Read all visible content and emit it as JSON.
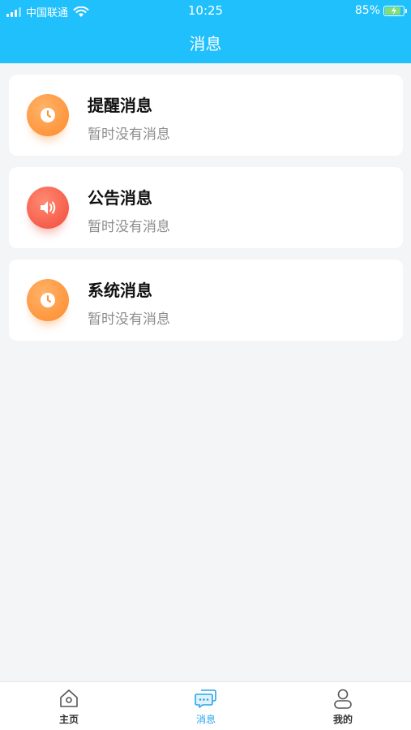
{
  "status_bar": {
    "carrier": "中国联通",
    "time": "10:25",
    "battery": "85%"
  },
  "header": {
    "title": "消息"
  },
  "messages": [
    {
      "title": "提醒消息",
      "subtitle": "暂时没有消息",
      "icon": "clock-icon",
      "color": "#ff8f33"
    },
    {
      "title": "公告消息",
      "subtitle": "暂时没有消息",
      "icon": "speaker-icon",
      "color": "#f25340"
    },
    {
      "title": "系统消息",
      "subtitle": "暂时没有消息",
      "icon": "clock-icon",
      "color": "#ff8f33"
    }
  ],
  "tabbar": {
    "items": [
      {
        "label": "主页",
        "icon": "home-icon"
      },
      {
        "label": "消息",
        "icon": "chat-icon",
        "active": true
      },
      {
        "label": "我的",
        "icon": "user-icon"
      }
    ],
    "active_color": "#2aa6e8"
  },
  "colors": {
    "header_bg": "#1fc0fb",
    "page_bg": "#f4f5f7"
  }
}
